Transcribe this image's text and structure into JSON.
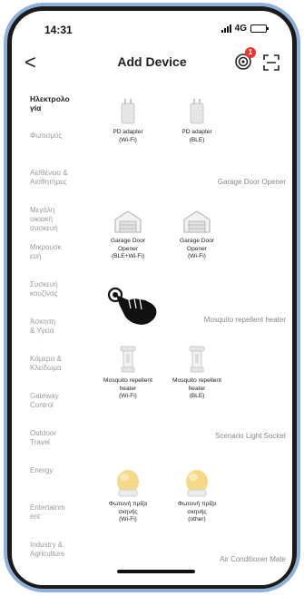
{
  "status_bar": {
    "time": "14:31",
    "network": "4G"
  },
  "header": {
    "title": "Add Device",
    "back_glyph": "<",
    "badge_count": "1"
  },
  "sidebar": {
    "items": [
      {
        "label": "Ηλεκτρολο\nγία",
        "active": true
      },
      {
        "label": "Φωτισμός",
        "active": false
      },
      {
        "label": "Αισθένεια &\nΑισθητήρες",
        "active": false
      },
      {
        "label": "Μεγάλη\nοικιακή\nσυσκευή",
        "active": false
      },
      {
        "label": "Μικρουσκ\nευή",
        "active": false
      },
      {
        "label": "Συσκευή\nκουζίνας",
        "active": false
      },
      {
        "label": "Άσκηση\n& Υγεία",
        "active": false
      },
      {
        "label": "Κάμερα &\nΚλείδωμα",
        "active": false
      },
      {
        "label": "Gateway\nControl",
        "active": false
      },
      {
        "label": "Outdoor\nTravel",
        "active": false
      },
      {
        "label": "Energy",
        "active": false
      },
      {
        "label": "Entertainm\nent",
        "active": false
      },
      {
        "label": "Industry &\nAgriculture",
        "active": false
      }
    ]
  },
  "sections": {
    "garage_door_opener": "Garage Door Opener",
    "mosquito_repellent_heater": "Mosquito repellent heater",
    "scenario_light_socket": "Scenario Light Socket",
    "air_conditioner_mate": "Air Conditioner Mate"
  },
  "devices": {
    "pd_adapter_wifi": "PD adapter\n(Wi-Fi)",
    "pd_adapter_ble": "PD adapter\n(BLE)",
    "garage_opener_ble_wifi": "Garage Door\nOpener\n(BLE+Wi-Fi)",
    "garage_opener_wifi": "Garage Door\nOpener\n(Wi-Fi)",
    "mosquito_heater_wifi": "Mosquito repellent\nheater\n(Wi-Fi)",
    "mosquito_heater_ble": "Mosquito repellent\nheater\n(BLE)",
    "scenario_light_wifi": "Φωτεινή πρίζα\nσκηνής\n(Wi-Fi)",
    "scenario_light_other": "Φωτεινή πρίζα\nσκηνής\n(other)"
  },
  "colors": {
    "frame": "#8fb0d9",
    "badge": "#e8372f",
    "lamp": "#f5d98a",
    "icon_gray": "#c8c8c8"
  },
  "icons": {
    "scan_nearby": "scan-nearby-icon",
    "scan": "scan-icon",
    "hand": "hand-pointer-icon"
  }
}
